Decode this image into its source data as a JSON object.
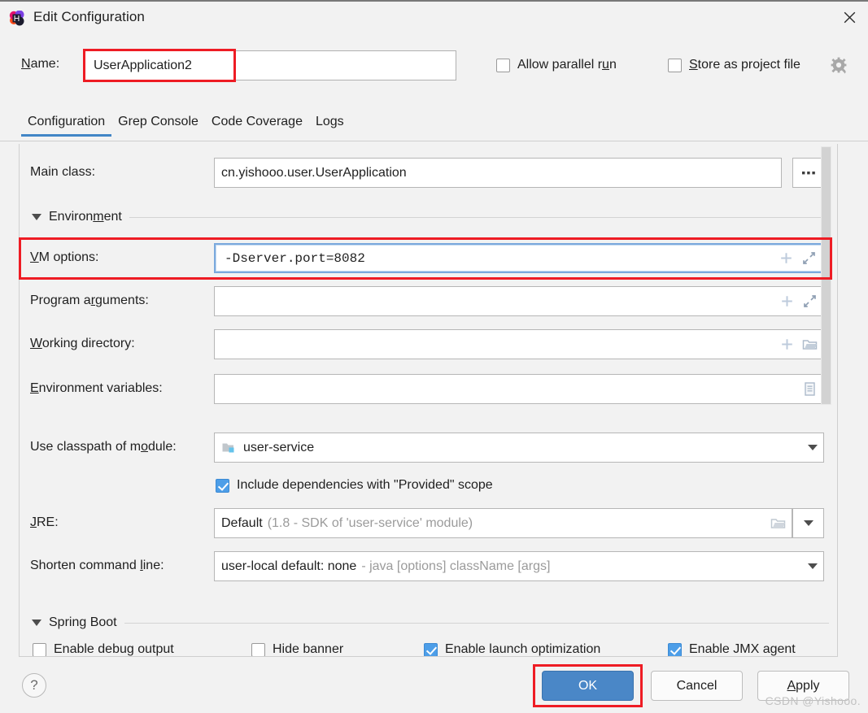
{
  "window": {
    "title": "Edit Configuration",
    "app_icon": "intellij-idea-icon",
    "close_icon": "close-icon"
  },
  "name_row": {
    "label": "Name:",
    "label_mnemonic": "N",
    "value": "UserApplication2",
    "placeholder": "",
    "highlight_color": "#ee1c24"
  },
  "top_options": [
    {
      "label": "Allow parallel run",
      "checked": false,
      "mnemonic": "u"
    },
    {
      "label": "Store as project file",
      "checked": false,
      "mnemonic": "S"
    }
  ],
  "gear_icon": "gear-icon",
  "tabs": [
    {
      "label": "Configuration",
      "active": true
    },
    {
      "label": "Grep Console",
      "active": false
    },
    {
      "label": "Code Coverage",
      "active": false
    },
    {
      "label": "Logs",
      "active": false
    }
  ],
  "form": {
    "main_class": {
      "label": "Main class:",
      "value": "cn.yishooo.user.UserApplication",
      "browse_button": "..."
    },
    "environment_section": {
      "title": "Environment",
      "mnemonic": "m",
      "expanded": true
    },
    "vm_options": {
      "label": "VM options:",
      "mnemonic": "V",
      "value": "-Dserver.port=8082",
      "focused": true,
      "highlighted": true,
      "icons": [
        "plus-icon",
        "expand-icon"
      ]
    },
    "program_arguments": {
      "label": "Program arguments:",
      "mnemonic": "r",
      "value": "",
      "icons": [
        "plus-icon",
        "expand-icon"
      ]
    },
    "working_directory": {
      "label": "Working directory:",
      "mnemonic": "W",
      "value": "",
      "icons": [
        "plus-icon",
        "folder-icon"
      ]
    },
    "environment_variables": {
      "label": "Environment variables:",
      "mnemonic": "E",
      "value": "",
      "icons": [
        "list-icon"
      ]
    },
    "classpath_module": {
      "label": "Use classpath of module:",
      "mnemonic": "o",
      "value": "user-service",
      "item_icon": "module-folder-icon"
    },
    "include_provided": {
      "label": "Include dependencies with \"Provided\" scope",
      "checked": true
    },
    "jre": {
      "label": "JRE:",
      "mnemonic": "J",
      "value": "Default",
      "value_detail": "(1.8 - SDK of 'user-service' module)",
      "icons": [
        "folder-icon",
        "chevron-down-icon"
      ]
    },
    "shorten_command_line": {
      "label": "Shorten command line:",
      "mnemonic": "l",
      "value": "user-local default: none",
      "value_detail": "- java [options] className [args]"
    },
    "spring_boot_section": {
      "title": "Spring Boot",
      "expanded": true
    },
    "spring_boot_options": [
      {
        "label": "Enable debug output",
        "checked": false
      },
      {
        "label": "Hide banner",
        "checked": false
      },
      {
        "label": "Enable launch optimization",
        "checked": true
      },
      {
        "label": "Enable JMX agent",
        "checked": true
      }
    ]
  },
  "footer": {
    "help": "?",
    "ok": "OK",
    "cancel": "Cancel",
    "apply": "Apply",
    "apply_mnemonic": "A",
    "ok_highlighted": true
  },
  "watermark": "CSDN @Yishooo."
}
